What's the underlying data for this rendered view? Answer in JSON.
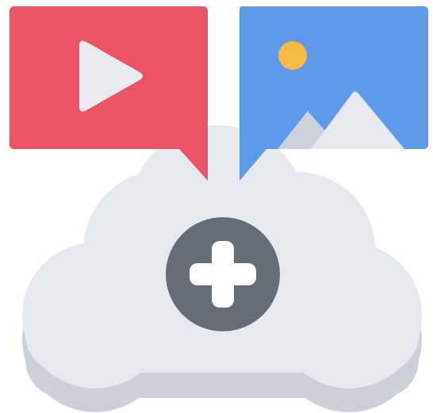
{
  "illustration": {
    "icons": [
      "video-play-icon",
      "image-mountain-icon",
      "cloud-icon",
      "plus-icon"
    ],
    "colors": {
      "video_bubble": "#ec5466",
      "video_play": "#e8ebf0",
      "image_bubble": "#5d9bea",
      "image_sun": "#f6bb42",
      "mountains_light": "#e6e9ee",
      "mountains_shade": "#cdd1d9",
      "cloud_top": "#e6e9ee",
      "cloud_shadow": "#ccd0d8",
      "plus_circle": "#656d78",
      "plus_sign": "#ffffff"
    }
  }
}
